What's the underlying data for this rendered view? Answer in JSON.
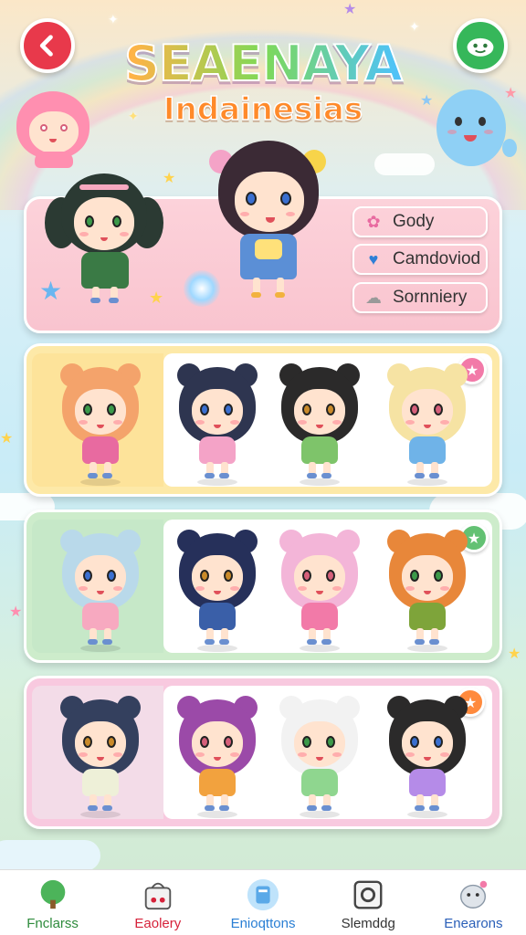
{
  "header": {
    "title": "SEAENAYA",
    "subtitle": "Indainesias",
    "back_icon": "chevron-left-icon",
    "profile_icon": "smiley-face-icon"
  },
  "featured": {
    "options": [
      {
        "label": "Gody",
        "icon": "paint-swirl-icon",
        "bg": "#fbe9b5"
      },
      {
        "label": "Camdoviod",
        "icon": "heart-icon",
        "bg": "#fbe9b5"
      },
      {
        "label": "Sornniery",
        "icon": "shell-icon",
        "bg": "#f6dbe6"
      }
    ]
  },
  "rows": [
    {
      "name": "row-yellow",
      "bg": "#fde9a8",
      "left_bg": "#fde39a",
      "badge_icon": "star-icon",
      "badge_color": "#f27aa8"
    },
    {
      "name": "row-green",
      "bg": "#cdeccb",
      "left_bg": "#c6e8c8",
      "badge_icon": "star-icon",
      "badge_color": "#63c173"
    },
    {
      "name": "row-pink",
      "bg": "#f8c9df",
      "left_bg": "#f3dce8",
      "badge_icon": "star-icon",
      "badge_color": "#ff8a3d"
    }
  ],
  "nav": [
    {
      "label": "Fnclarss",
      "icon": "tree-icon",
      "color": "#2e8b3c"
    },
    {
      "label": "Eaolery",
      "icon": "bag-icon",
      "color": "#d6223a"
    },
    {
      "label": "Enioqttons",
      "icon": "card-icon",
      "color": "#2a7fd4"
    },
    {
      "label": "Slemddg",
      "icon": "frame-icon",
      "color": "#333333"
    },
    {
      "label": "Enearons",
      "icon": "ghost-icon",
      "color": "#2a5fb8"
    }
  ],
  "colors": {
    "back": "#e8394b",
    "profile": "#36b75a",
    "title_sub": "#ff8a2a"
  }
}
